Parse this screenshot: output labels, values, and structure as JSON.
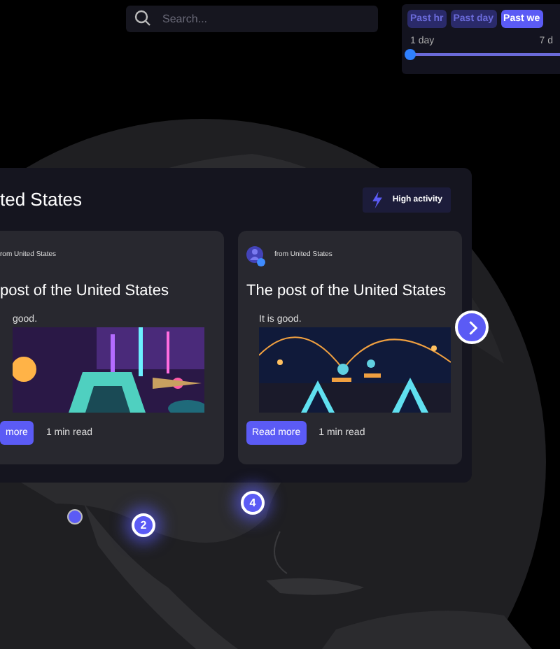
{
  "search": {
    "placeholder": "Search..."
  },
  "time_filter": {
    "buttons": [
      {
        "label": "Past hr",
        "selected": false
      },
      {
        "label": "Past day",
        "selected": false
      },
      {
        "label": "Past we",
        "selected": true
      }
    ],
    "range_labels": [
      "1 day",
      "7 d"
    ],
    "slider": {
      "level": 0
    }
  },
  "panel": {
    "title": "ted States",
    "badge": "High activity",
    "posts": [
      {
        "source": "rom United States",
        "title": "post of the United States",
        "text": "good.",
        "button": "more",
        "read_time": "1 min read"
      },
      {
        "avatar": true,
        "source": "from United States",
        "title": "The post of the United States",
        "text": "It is good.",
        "button": "Read more",
        "read_time": "1 min read"
      }
    ]
  },
  "markers": [
    {
      "kind": "dot"
    },
    {
      "kind": "cluster",
      "count": "2"
    },
    {
      "kind": "cluster",
      "count": "4"
    }
  ]
}
